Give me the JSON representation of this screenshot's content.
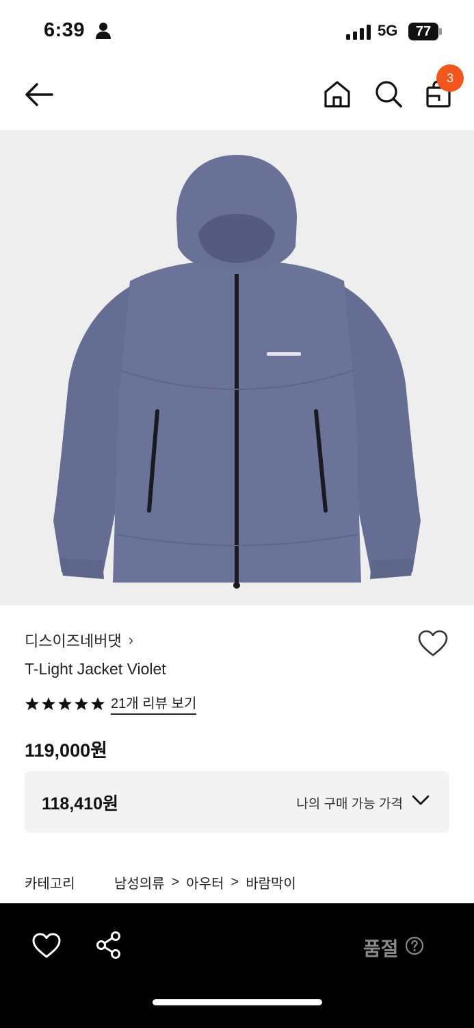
{
  "status_bar": {
    "time": "6:39",
    "network": "5G",
    "battery": "77"
  },
  "nav": {
    "cart_count": "3"
  },
  "icons": {
    "back": "arrow-left-icon",
    "home": "home-icon",
    "search": "search-icon",
    "bag": "shopping-bag-icon",
    "wishlist": "heart-outline-icon",
    "share": "share-icon",
    "help": "question-circle-icon"
  },
  "colors": {
    "badge": "#f2561d",
    "jacket": "#6a7196",
    "image_bg": "#eeeeee",
    "bottom_bar": "#000000"
  },
  "product": {
    "brand": "디스이즈네버댓",
    "brand_chevron": "›",
    "name": "T-Light Jacket Violet",
    "rating_stars": 5,
    "review_link": "21개 리뷰 보기",
    "price": "119,000원",
    "member_price": "118,410원",
    "member_price_label": "나의 구매 가능 가격"
  },
  "category": {
    "label": "카테고리",
    "path": [
      "남성의류",
      "아우터",
      "바람막이"
    ],
    "separator": ">"
  },
  "bottom_bar": {
    "status": "품절"
  }
}
